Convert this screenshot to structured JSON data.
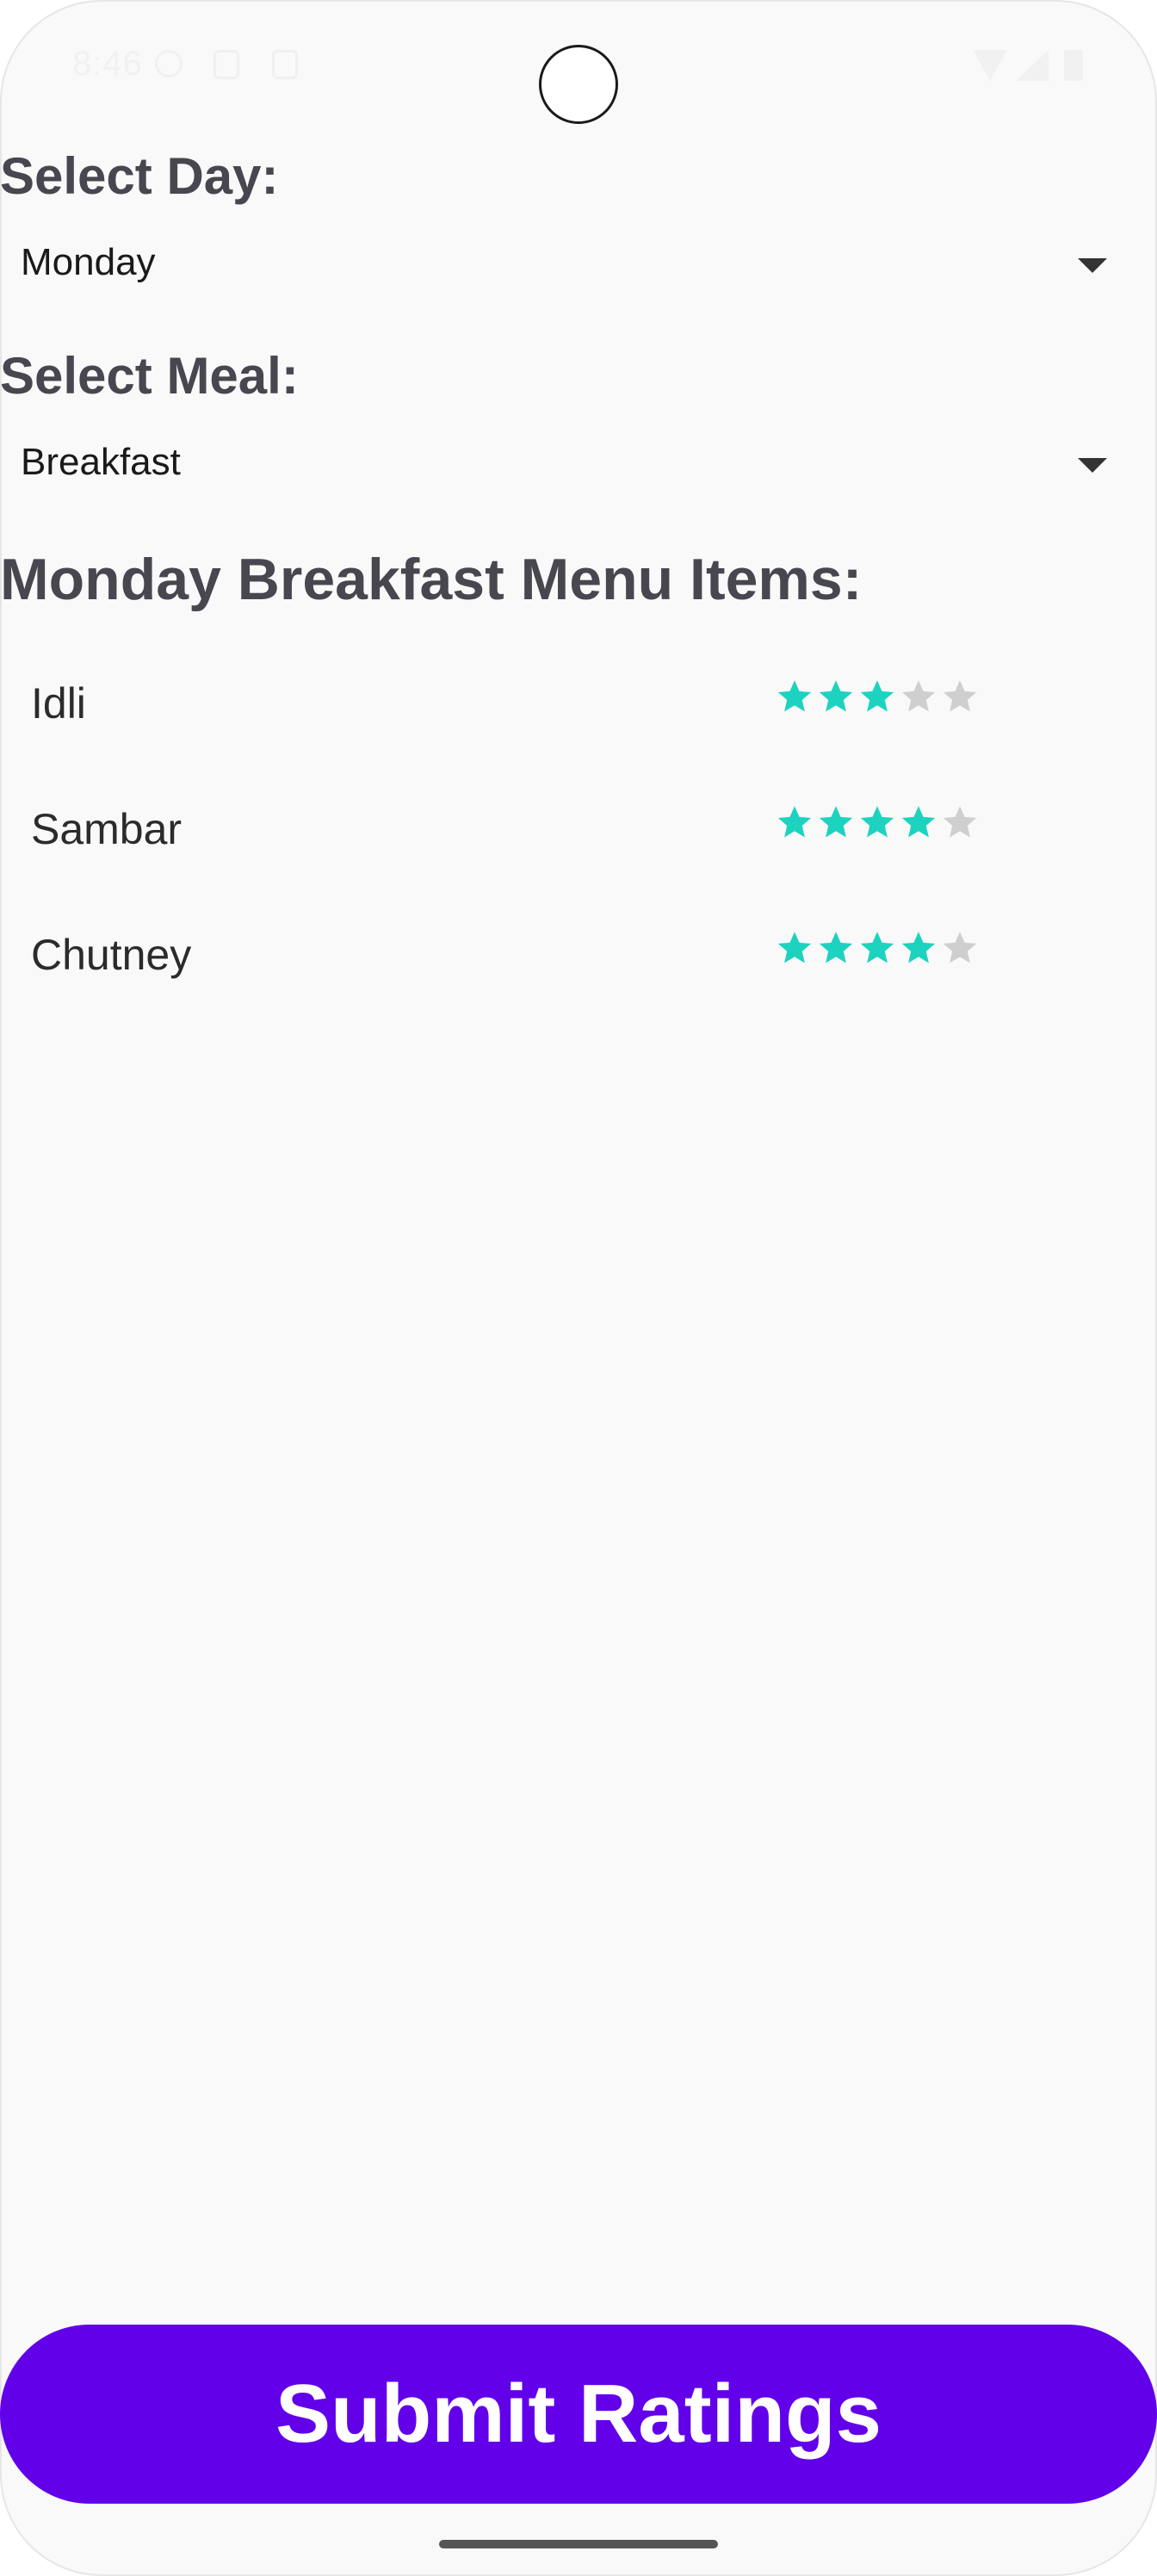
{
  "status_bar": {
    "time": "8:46"
  },
  "day_selector": {
    "label": "Select Day:",
    "value": "Monday"
  },
  "meal_selector": {
    "label": "Select Meal:",
    "value": "Breakfast"
  },
  "menu": {
    "heading": "Monday Breakfast Menu Items:",
    "items": [
      {
        "name": "Idli",
        "rating": 3,
        "max_rating": 5
      },
      {
        "name": "Sambar",
        "rating": 4,
        "max_rating": 5
      },
      {
        "name": "Chutney",
        "rating": 4,
        "max_rating": 5
      }
    ],
    "star_color_filled": "#1dd3c0",
    "star_color_empty": "#cfcfcf"
  },
  "submit_button": {
    "label": "Submit Ratings",
    "color": "#6200ea"
  }
}
